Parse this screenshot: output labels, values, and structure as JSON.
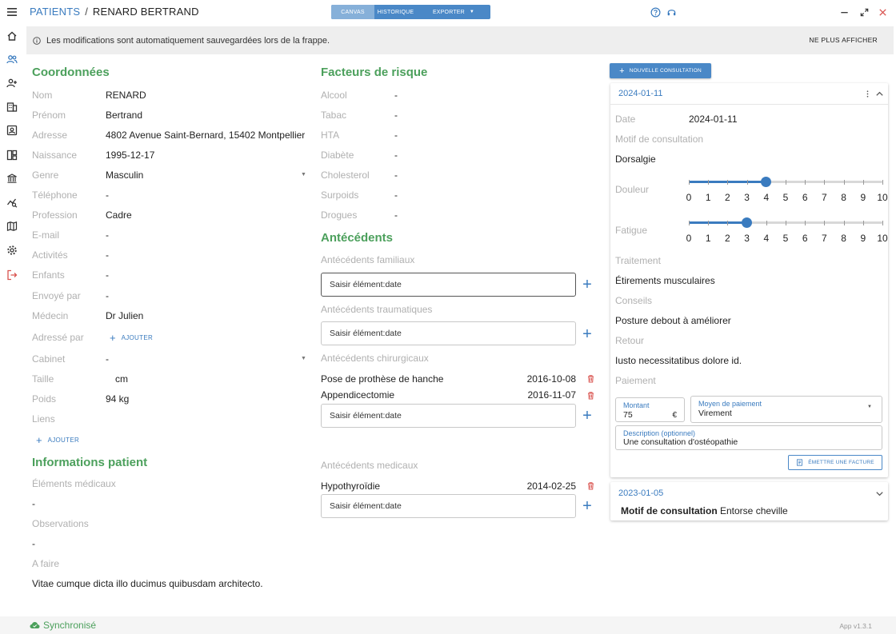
{
  "sidebar": {
    "icons": [
      "menu-icon",
      "home-icon",
      "users-icon",
      "add-user-icon",
      "building-icon",
      "contact-card-icon",
      "dashboard-icon",
      "bank-icon",
      "analytics-icon",
      "map-icon",
      "settings-icon",
      "logout-icon"
    ]
  },
  "header": {
    "breadcrumb_root": "PATIENTS",
    "breadcrumb_sep": "/",
    "breadcrumb_current": "RENARD BERTRAND",
    "tabs": [
      {
        "label": "CANVAS",
        "active": true
      },
      {
        "label": "HISTORIQUE",
        "active": false
      },
      {
        "label": "EXPORTER",
        "active": false
      }
    ],
    "accent_color": "#4a88c7"
  },
  "banner": {
    "text": "Les modifications sont automatiquement sauvegardées lors de la frappe.",
    "dismiss_label": "NE PLUS AFFICHER"
  },
  "coordonnees": {
    "title": "Coordonnées",
    "fields": [
      {
        "label": "Nom",
        "value": "RENARD"
      },
      {
        "label": "Prénom",
        "value": "Bertrand"
      },
      {
        "label": "Adresse",
        "value": "4802 Avenue Saint-Bernard, 15402 Montpellier"
      },
      {
        "label": "Naissance",
        "value": "1995-12-17"
      },
      {
        "label": "Genre",
        "value": "Masculin"
      },
      {
        "label": "Téléphone",
        "value": "-"
      },
      {
        "label": "Profession",
        "value": "Cadre"
      },
      {
        "label": "E-mail",
        "value": "-"
      },
      {
        "label": "Activités",
        "value": "-"
      },
      {
        "label": "Enfants",
        "value": "-"
      },
      {
        "label": "Envoyé par",
        "value": "-"
      },
      {
        "label": "Médecin",
        "value": "Dr Julien"
      },
      {
        "label": "Adressé par",
        "value": ""
      },
      {
        "label": "Cabinet",
        "value": "-"
      },
      {
        "label": "Taille",
        "value": "cm"
      },
      {
        "label": "Poids",
        "value": "94 kg"
      },
      {
        "label": "Liens",
        "value": ""
      }
    ],
    "ajouter_label": "AJOUTER",
    "ajouter_liens_label": "AJOUTER"
  },
  "informations": {
    "title": "Informations patient",
    "elements_label": "Éléments médicaux",
    "elements_value": "-",
    "observations_label": "Observations",
    "observations_value": "-",
    "afaire_label": "A faire",
    "afaire_value": "Vitae cumque dicta illo ducimus quibusdam architecto."
  },
  "facteurs": {
    "title": "Facteurs de risque",
    "fields": [
      {
        "label": "Alcool",
        "value": "-"
      },
      {
        "label": "Tabac",
        "value": "-"
      },
      {
        "label": "HTA",
        "value": "-"
      },
      {
        "label": "Diabète",
        "value": "-"
      },
      {
        "label": "Cholesterol",
        "value": "-"
      },
      {
        "label": "Surpoids",
        "value": "-"
      },
      {
        "label": "Drogues",
        "value": "-"
      }
    ]
  },
  "antecedents": {
    "title": "Antécédents",
    "placeholder": "Saisir élément:date",
    "familiaux_label": "Antécédents familiaux",
    "traumatiques_label": "Antécédents traumatiques",
    "chirurgicaux_label": "Antécédents chirurgicaux",
    "chirurgicaux_items": [
      {
        "label": "Pose de prothèse de hanche",
        "date": "2016-10-08"
      },
      {
        "label": "Appendicectomie",
        "date": "2016-11-07"
      }
    ],
    "medicaux_label": "Antécédents medicaux",
    "medicaux_items": [
      {
        "label": "Hypothyroïdie",
        "date": "2014-02-25"
      }
    ]
  },
  "consultations": {
    "new_label": "NOUVELLE CONSULTATION",
    "current": {
      "date_header": "2024-01-11",
      "date_label": "Date",
      "date_value": "2024-01-11",
      "motif_label": "Motif de consultation",
      "motif_value": "Dorsalgie",
      "douleur_label": "Douleur",
      "douleur_value": 4,
      "fatigue_label": "Fatigue",
      "fatigue_value": 3,
      "scale_ticks": [
        "0",
        "1",
        "2",
        "3",
        "4",
        "5",
        "6",
        "7",
        "8",
        "9",
        "10"
      ],
      "traitement_label": "Traitement",
      "traitement_value": "Étirements musculaires",
      "conseils_label": "Conseils",
      "conseils_value": "Posture debout à améliorer",
      "retour_label": "Retour",
      "retour_value": "Iusto necessitatibus dolore id.",
      "paiement_label": "Paiement",
      "montant_label": "Montant",
      "montant_value": "75",
      "currency": "€",
      "moyen_label": "Moyen de paiement",
      "moyen_value": "Virement",
      "description_label": "Description (optionnel)",
      "description_value": "Une consultation d'ostéopathie",
      "facture_label": "ÉMETTRE UNE FACTURE"
    },
    "previous": {
      "date_header": "2023-01-05",
      "motif_label": "Motif de consultation",
      "motif_value": "Entorse cheville"
    }
  },
  "footer": {
    "sync_label": "Synchronisé",
    "version": "App v1.3.1"
  }
}
